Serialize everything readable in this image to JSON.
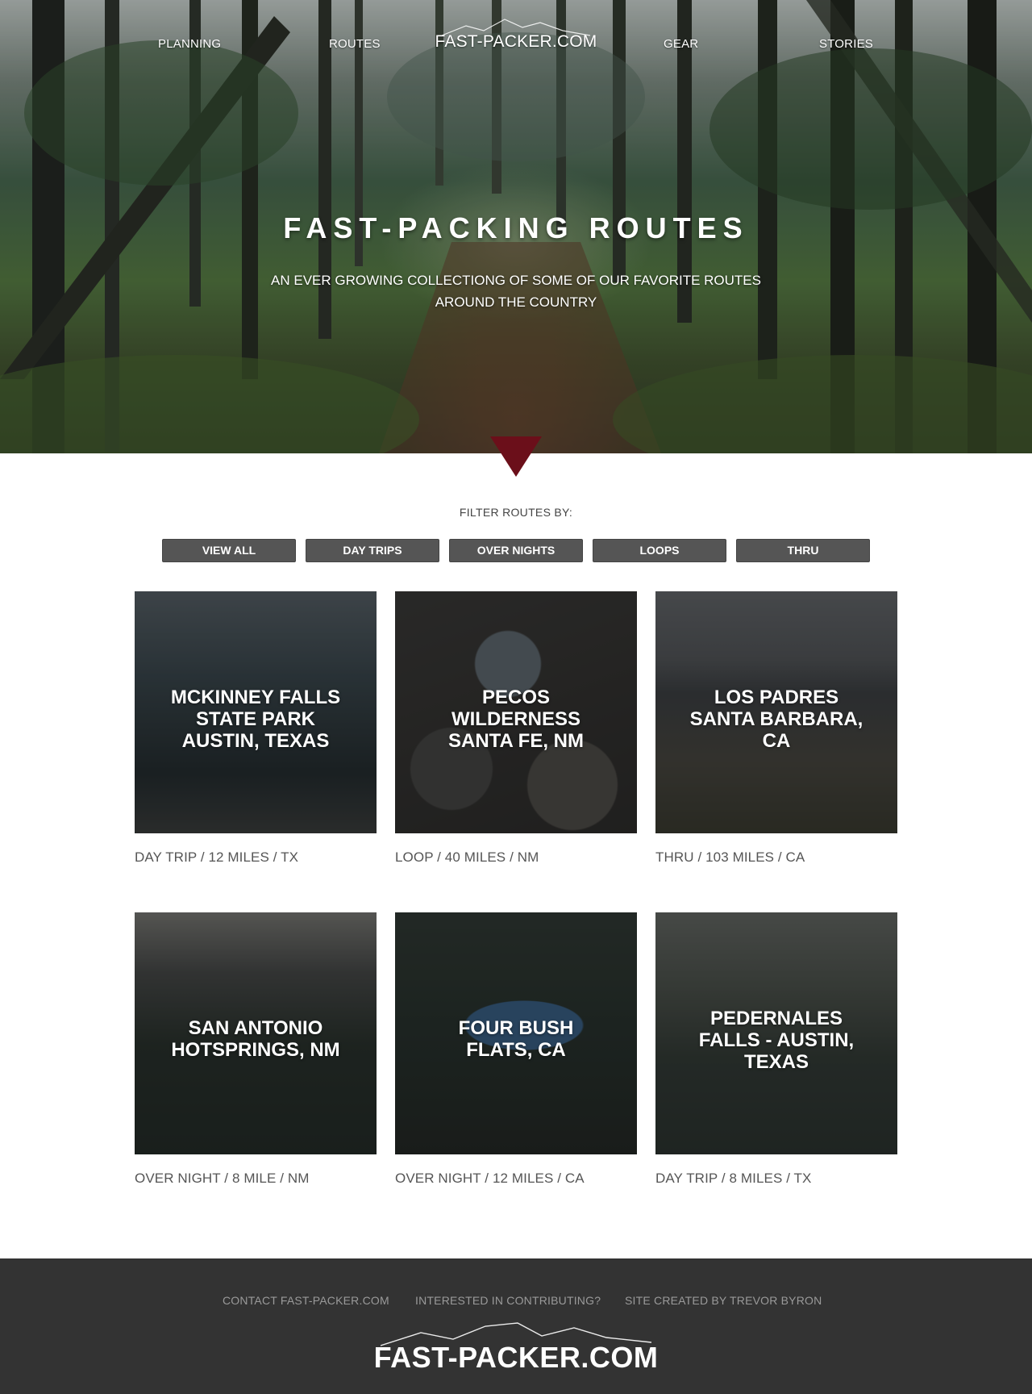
{
  "nav": {
    "planning": "PLANNING",
    "routes": "ROUTES",
    "logo": "FAST-PACKER.COM",
    "gear": "GEAR",
    "stories": "STORIES"
  },
  "hero": {
    "title": "FAST-PACKING ROUTES",
    "subtitle_line1": "AN EVER GROWING COLLECTIONG OF SOME OF OUR FAVORITE ROUTES",
    "subtitle_line2": "AROUND THE COUNTRY",
    "arrow_color": "#6b0f1a"
  },
  "filter": {
    "label": "FILTER ROUTES BY:",
    "buttons": [
      "VIEW ALL",
      "DAY TRIPS",
      "OVER NIGHTS",
      "LOOPS",
      "THRU"
    ]
  },
  "routes": [
    {
      "title": [
        "MCKINNEY FALLS",
        "STATE PARK",
        "AUSTIN, TEXAS"
      ],
      "meta": "DAY TRIP / 12 MILES / TX"
    },
    {
      "title": [
        "PECOS",
        "WILDERNESS",
        "SANTA FE, NM"
      ],
      "meta": "LOOP / 40 MILES / NM"
    },
    {
      "title": [
        "LOS PADRES",
        "SANTA BARBARA,",
        "CA"
      ],
      "meta": "THRU / 103 MILES / CA"
    },
    {
      "title": [
        "SAN ANTONIO",
        "HOTSPRINGS, NM"
      ],
      "meta": "OVER NIGHT / 8 MILE / NM"
    },
    {
      "title": [
        "FOUR BUSH",
        "FLATS, CA"
      ],
      "meta": "OVER NIGHT / 12 MILES / CA"
    },
    {
      "title": [
        "PEDERNALES",
        "FALLS - AUSTIN,",
        "TEXAS"
      ],
      "meta": "DAY TRIP / 8 MILES / TX"
    }
  ],
  "footer": {
    "contact": "CONTACT FAST-PACKER.COM",
    "contribute": "INTERESTED IN CONTRIBUTING?",
    "credit": "SITE CREATED BY TREVOR BYRON",
    "logo": "FAST-PACKER.COM"
  },
  "colors": {
    "accent": "#6b0f1a",
    "button": "#555555",
    "footer": "#333333"
  }
}
